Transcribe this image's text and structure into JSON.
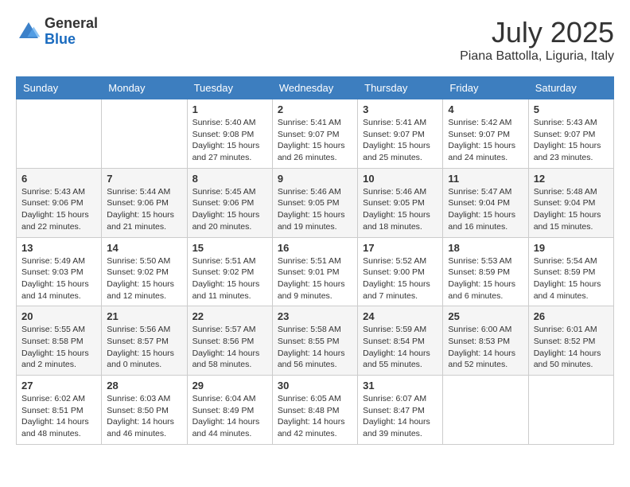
{
  "header": {
    "logo_general": "General",
    "logo_blue": "Blue",
    "month_year": "July 2025",
    "location": "Piana Battolla, Liguria, Italy"
  },
  "days_of_week": [
    "Sunday",
    "Monday",
    "Tuesday",
    "Wednesday",
    "Thursday",
    "Friday",
    "Saturday"
  ],
  "weeks": [
    [
      {
        "day": "",
        "info": ""
      },
      {
        "day": "",
        "info": ""
      },
      {
        "day": "1",
        "info": "Sunrise: 5:40 AM\nSunset: 9:08 PM\nDaylight: 15 hours\nand 27 minutes."
      },
      {
        "day": "2",
        "info": "Sunrise: 5:41 AM\nSunset: 9:07 PM\nDaylight: 15 hours\nand 26 minutes."
      },
      {
        "day": "3",
        "info": "Sunrise: 5:41 AM\nSunset: 9:07 PM\nDaylight: 15 hours\nand 25 minutes."
      },
      {
        "day": "4",
        "info": "Sunrise: 5:42 AM\nSunset: 9:07 PM\nDaylight: 15 hours\nand 24 minutes."
      },
      {
        "day": "5",
        "info": "Sunrise: 5:43 AM\nSunset: 9:07 PM\nDaylight: 15 hours\nand 23 minutes."
      }
    ],
    [
      {
        "day": "6",
        "info": "Sunrise: 5:43 AM\nSunset: 9:06 PM\nDaylight: 15 hours\nand 22 minutes."
      },
      {
        "day": "7",
        "info": "Sunrise: 5:44 AM\nSunset: 9:06 PM\nDaylight: 15 hours\nand 21 minutes."
      },
      {
        "day": "8",
        "info": "Sunrise: 5:45 AM\nSunset: 9:06 PM\nDaylight: 15 hours\nand 20 minutes."
      },
      {
        "day": "9",
        "info": "Sunrise: 5:46 AM\nSunset: 9:05 PM\nDaylight: 15 hours\nand 19 minutes."
      },
      {
        "day": "10",
        "info": "Sunrise: 5:46 AM\nSunset: 9:05 PM\nDaylight: 15 hours\nand 18 minutes."
      },
      {
        "day": "11",
        "info": "Sunrise: 5:47 AM\nSunset: 9:04 PM\nDaylight: 15 hours\nand 16 minutes."
      },
      {
        "day": "12",
        "info": "Sunrise: 5:48 AM\nSunset: 9:04 PM\nDaylight: 15 hours\nand 15 minutes."
      }
    ],
    [
      {
        "day": "13",
        "info": "Sunrise: 5:49 AM\nSunset: 9:03 PM\nDaylight: 15 hours\nand 14 minutes."
      },
      {
        "day": "14",
        "info": "Sunrise: 5:50 AM\nSunset: 9:02 PM\nDaylight: 15 hours\nand 12 minutes."
      },
      {
        "day": "15",
        "info": "Sunrise: 5:51 AM\nSunset: 9:02 PM\nDaylight: 15 hours\nand 11 minutes."
      },
      {
        "day": "16",
        "info": "Sunrise: 5:51 AM\nSunset: 9:01 PM\nDaylight: 15 hours\nand 9 minutes."
      },
      {
        "day": "17",
        "info": "Sunrise: 5:52 AM\nSunset: 9:00 PM\nDaylight: 15 hours\nand 7 minutes."
      },
      {
        "day": "18",
        "info": "Sunrise: 5:53 AM\nSunset: 8:59 PM\nDaylight: 15 hours\nand 6 minutes."
      },
      {
        "day": "19",
        "info": "Sunrise: 5:54 AM\nSunset: 8:59 PM\nDaylight: 15 hours\nand 4 minutes."
      }
    ],
    [
      {
        "day": "20",
        "info": "Sunrise: 5:55 AM\nSunset: 8:58 PM\nDaylight: 15 hours\nand 2 minutes."
      },
      {
        "day": "21",
        "info": "Sunrise: 5:56 AM\nSunset: 8:57 PM\nDaylight: 15 hours\nand 0 minutes."
      },
      {
        "day": "22",
        "info": "Sunrise: 5:57 AM\nSunset: 8:56 PM\nDaylight: 14 hours\nand 58 minutes."
      },
      {
        "day": "23",
        "info": "Sunrise: 5:58 AM\nSunset: 8:55 PM\nDaylight: 14 hours\nand 56 minutes."
      },
      {
        "day": "24",
        "info": "Sunrise: 5:59 AM\nSunset: 8:54 PM\nDaylight: 14 hours\nand 55 minutes."
      },
      {
        "day": "25",
        "info": "Sunrise: 6:00 AM\nSunset: 8:53 PM\nDaylight: 14 hours\nand 52 minutes."
      },
      {
        "day": "26",
        "info": "Sunrise: 6:01 AM\nSunset: 8:52 PM\nDaylight: 14 hours\nand 50 minutes."
      }
    ],
    [
      {
        "day": "27",
        "info": "Sunrise: 6:02 AM\nSunset: 8:51 PM\nDaylight: 14 hours\nand 48 minutes."
      },
      {
        "day": "28",
        "info": "Sunrise: 6:03 AM\nSunset: 8:50 PM\nDaylight: 14 hours\nand 46 minutes."
      },
      {
        "day": "29",
        "info": "Sunrise: 6:04 AM\nSunset: 8:49 PM\nDaylight: 14 hours\nand 44 minutes."
      },
      {
        "day": "30",
        "info": "Sunrise: 6:05 AM\nSunset: 8:48 PM\nDaylight: 14 hours\nand 42 minutes."
      },
      {
        "day": "31",
        "info": "Sunrise: 6:07 AM\nSunset: 8:47 PM\nDaylight: 14 hours\nand 39 minutes."
      },
      {
        "day": "",
        "info": ""
      },
      {
        "day": "",
        "info": ""
      }
    ]
  ]
}
